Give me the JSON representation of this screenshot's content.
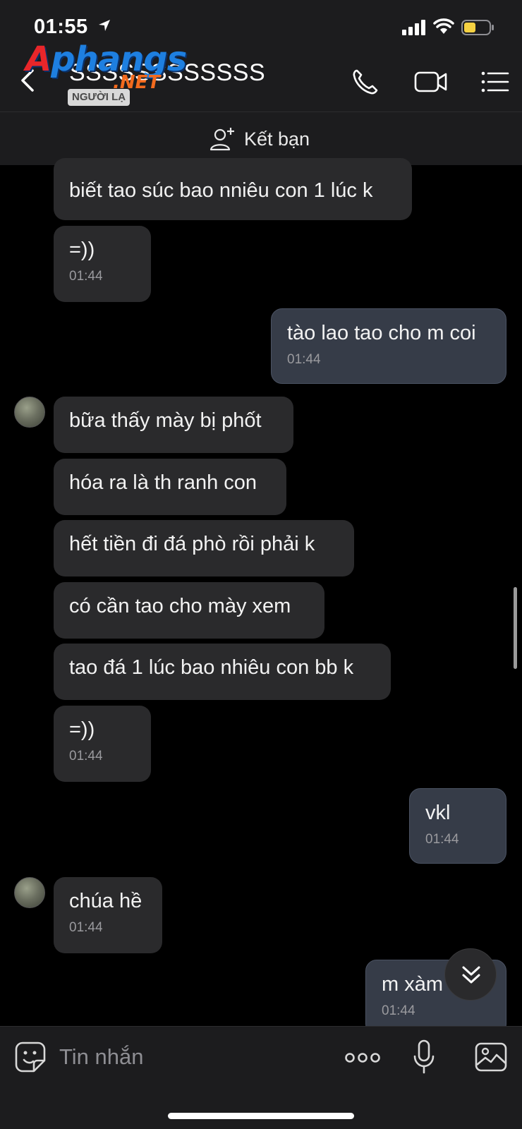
{
  "status_bar": {
    "time": "01:55"
  },
  "watermark": {
    "brand": "phangs",
    "brand_first": "A",
    "suffix": ".NET"
  },
  "header": {
    "title": "SSSSSSSSSSSS",
    "stranger_badge": "NGƯỜI LẠ"
  },
  "friend_bar": {
    "label": "Kết bạn"
  },
  "messages": [
    {
      "text": "biết tao súc bao nniêu con 1 lúc k",
      "time": ""
    },
    {
      "text": "=))",
      "time": "01:44"
    },
    {
      "text": "tào lao tao cho m coi",
      "time": "01:44"
    },
    {
      "text": "bữa thấy mày bị phốt",
      "time": ""
    },
    {
      "text": "hóa ra là th ranh con",
      "time": ""
    },
    {
      "text": "hết tiền đi đá phò rồi phải k",
      "time": ""
    },
    {
      "text": "có cần tao cho mày xem",
      "time": ""
    },
    {
      "text": "tao đá 1 lúc bao nhiêu con bb k",
      "time": ""
    },
    {
      "text": "=))",
      "time": "01:44"
    },
    {
      "text": "vkl",
      "time": "01:44"
    },
    {
      "text": "chúa hề",
      "time": "01:44"
    },
    {
      "text": "m xàm",
      "time": "01:44"
    }
  ],
  "input_bar": {
    "placeholder": "Tin nhắn"
  },
  "icons": {
    "back": "chevron-left-icon",
    "call": "phone-icon",
    "video": "video-camera-icon",
    "menu": "list-menu-icon",
    "add_friend": "add-user-icon",
    "sticker": "sticker-smile-icon",
    "more": "more-dots-icon",
    "mic": "microphone-icon",
    "image": "image-icon",
    "jump": "double-chevron-down-icon"
  },
  "colors": {
    "background": "#000000",
    "bar": "#1c1c1e",
    "incoming_bubble": "#2a2a2c",
    "outgoing_bubble": "#363c48",
    "battery": "#f5d142"
  }
}
